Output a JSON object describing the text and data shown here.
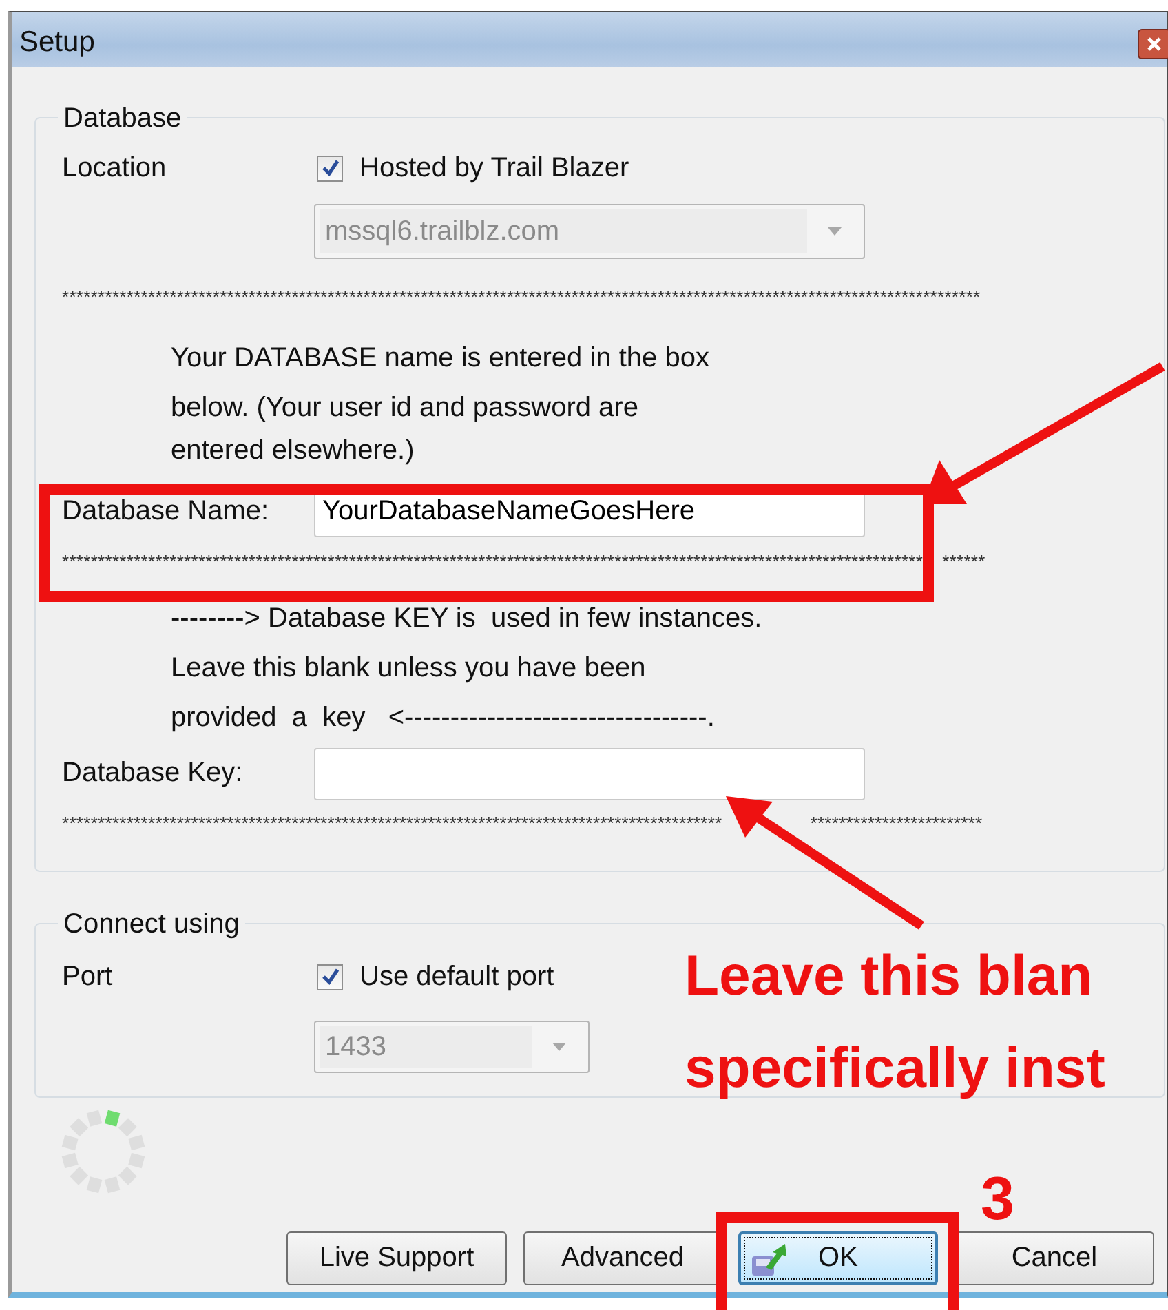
{
  "window": {
    "title": "Setup"
  },
  "database_group": {
    "title": "Database",
    "location_label": "Location",
    "hosted_checkbox": {
      "label": "Hosted by Trail Blazer",
      "checked": true
    },
    "server_combo": {
      "value": "mssql6.trailblz.com",
      "disabled": true
    },
    "separators": [
      [
        "********************************************************************************************************************************"
      ],
      [
        "************************************************************************************************************************",
        "******"
      ],
      [
        "********************************************************************************************",
        "************************"
      ]
    ],
    "name_note": [
      "Your DATABASE name is entered in the box",
      "below. (Your user id and password are",
      "entered elsewhere.)"
    ],
    "database_name": {
      "label": "Database Name:",
      "value": "YourDatabaseNameGoesHere"
    },
    "key_note": [
      "--------> Database KEY is  used in few instances.",
      "Leave this blank unless you have been",
      "provided  a  key   <---------------------------------."
    ],
    "database_key": {
      "label": "Database Key:"
    }
  },
  "connect_group": {
    "title": "Connect using",
    "port_label": "Port",
    "default_port_checkbox": {
      "label": "Use default port",
      "checked": true
    },
    "port_combo": {
      "value": "1433",
      "disabled": true
    }
  },
  "buttons": [
    {
      "label": "Live Support",
      "focused": false,
      "icon": false
    },
    {
      "label": "Advanced",
      "focused": false,
      "icon": false
    },
    {
      "label": "OK",
      "focused": true,
      "icon": true
    },
    {
      "label": "Cancel",
      "focused": false,
      "icon": false
    }
  ],
  "annotations": {
    "callout_lines": [
      "Leave this blan",
      "specifically inst"
    ],
    "step_number": "3"
  }
}
